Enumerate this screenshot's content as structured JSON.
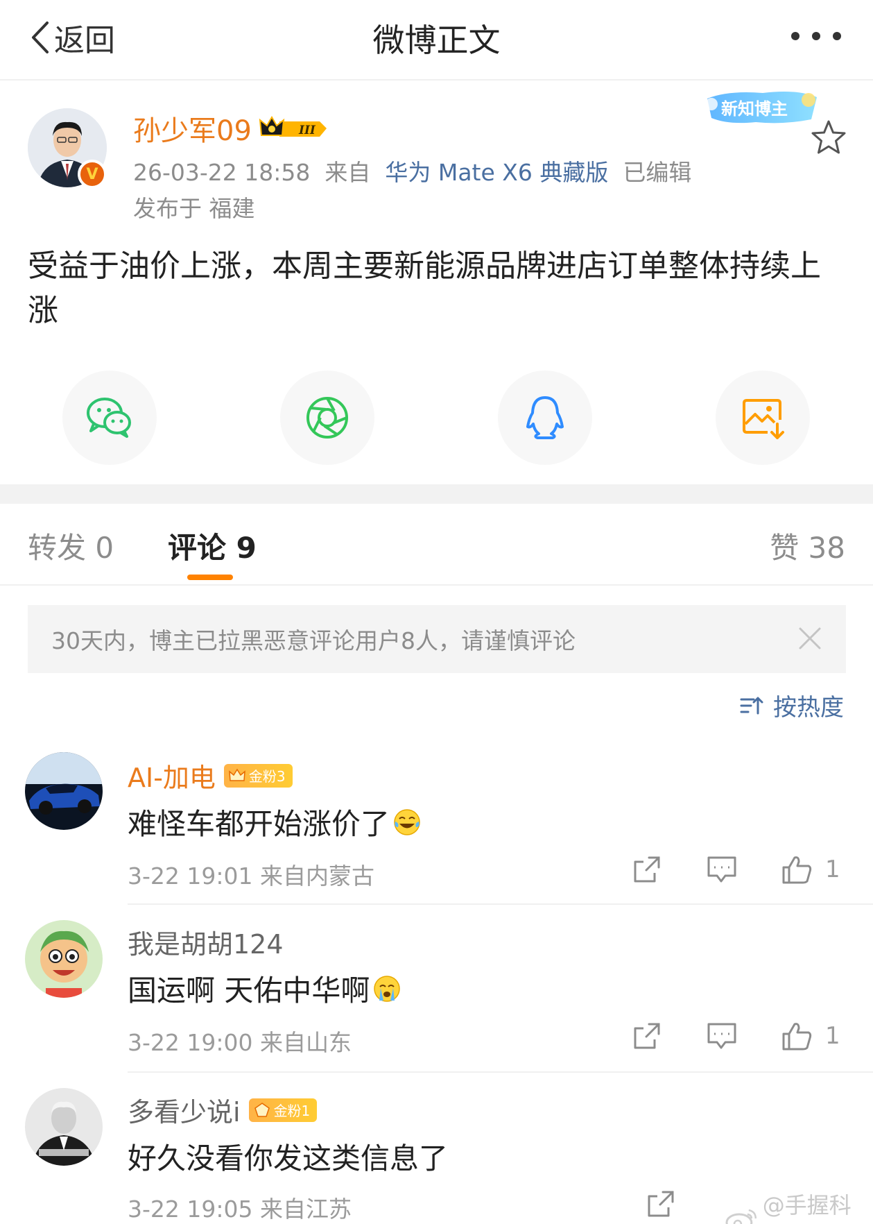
{
  "nav": {
    "back_label": "返回",
    "title": "微博正文"
  },
  "post": {
    "author": "孙少军09",
    "level_badge": "III",
    "badge_text": "新知博主",
    "verified_mark": "V",
    "time": "26-03-22 18:58",
    "source_prefix": "来自",
    "source": "华为 Mate X6 典藏版",
    "edited": "已编辑",
    "location": "发布于 福建",
    "text": "受益于油价上涨，本周主要新能源品牌进店订单整体持续上涨"
  },
  "share": [
    {
      "name": "wechat-icon",
      "color": "#2ec36f"
    },
    {
      "name": "moments-icon",
      "color": "#34c759"
    },
    {
      "name": "qq-icon",
      "color": "#2f8cff"
    },
    {
      "name": "save-image-icon",
      "color": "#ff9d00"
    }
  ],
  "tabs": {
    "repost": "转发 0",
    "comment": "评论 9",
    "like": "赞 38"
  },
  "notice": "30天内，博主已拉黑恶意评论用户8人，请谨慎评论",
  "sort_label": "按热度",
  "comments": [
    {
      "name": "AI-加电",
      "badge": "金粉3",
      "text": "难怪车都开始涨价了",
      "emoji": "laughing-tears-emoji",
      "meta": "3-22 19:01 来自内蒙古",
      "likes": "1"
    },
    {
      "name": "我是胡胡124",
      "badge": "",
      "text": "国运啊 天佑中华啊",
      "emoji": "crying-emoji",
      "meta": "3-22 19:00 来自山东",
      "likes": "1"
    },
    {
      "name": "多看少说i",
      "badge": "金粉1",
      "text": "好久没看你发这类信息了",
      "emoji": "",
      "meta": "3-22 19:05 来自江苏",
      "likes": ""
    }
  ],
  "watermark": "@手握科技",
  "colors": {
    "accent": "#ff8200",
    "author_orange": "#ea7b1c",
    "link_blue": "#4a6fa1"
  }
}
